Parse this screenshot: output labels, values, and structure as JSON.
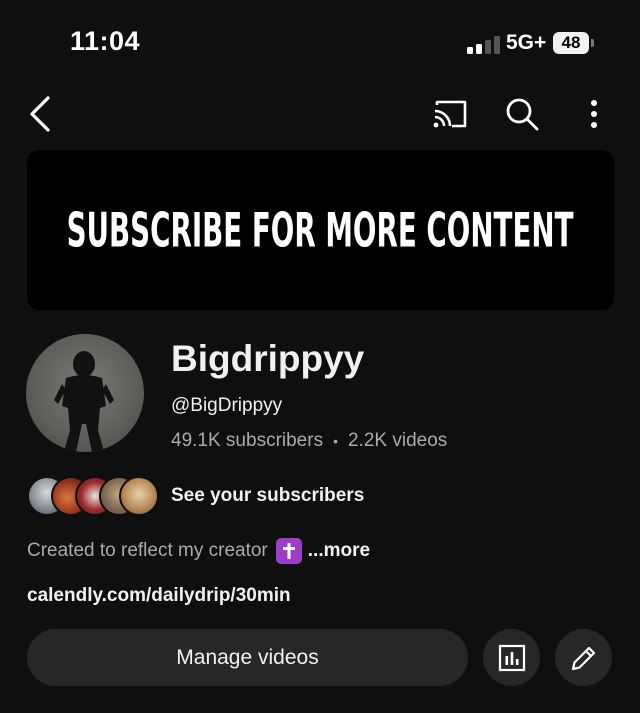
{
  "status_bar": {
    "time": "11:04",
    "network": "5G+",
    "battery": "48"
  },
  "top_bar": {
    "icons": [
      "chevron-left-icon",
      "cast-icon",
      "search-icon",
      "more-vertical-icon"
    ]
  },
  "banner": {
    "text": "SUBSCRIBE FOR MORE CONTENT"
  },
  "channel": {
    "name": "Bigdrippyy",
    "handle": "@BigDrippyy",
    "subscribers": "49.1K subscribers",
    "separator": "•",
    "videos": "2.2K videos"
  },
  "subscribers_row": {
    "label": "See your subscribers"
  },
  "description": {
    "text": "Created to reflect my creator",
    "emoji": "latin-cross-emoji",
    "more": "...more"
  },
  "link": "calendly.com/dailydrip/30min",
  "actions": {
    "manage_label": "Manage videos",
    "analytics_icon": "analytics-icon",
    "edit_icon": "pencil-icon"
  },
  "colors": {
    "background": "#0f0f0f",
    "button_bg": "#272727",
    "secondary_text": "#aaaaaa",
    "badge_purple": "#9b3fc7"
  }
}
